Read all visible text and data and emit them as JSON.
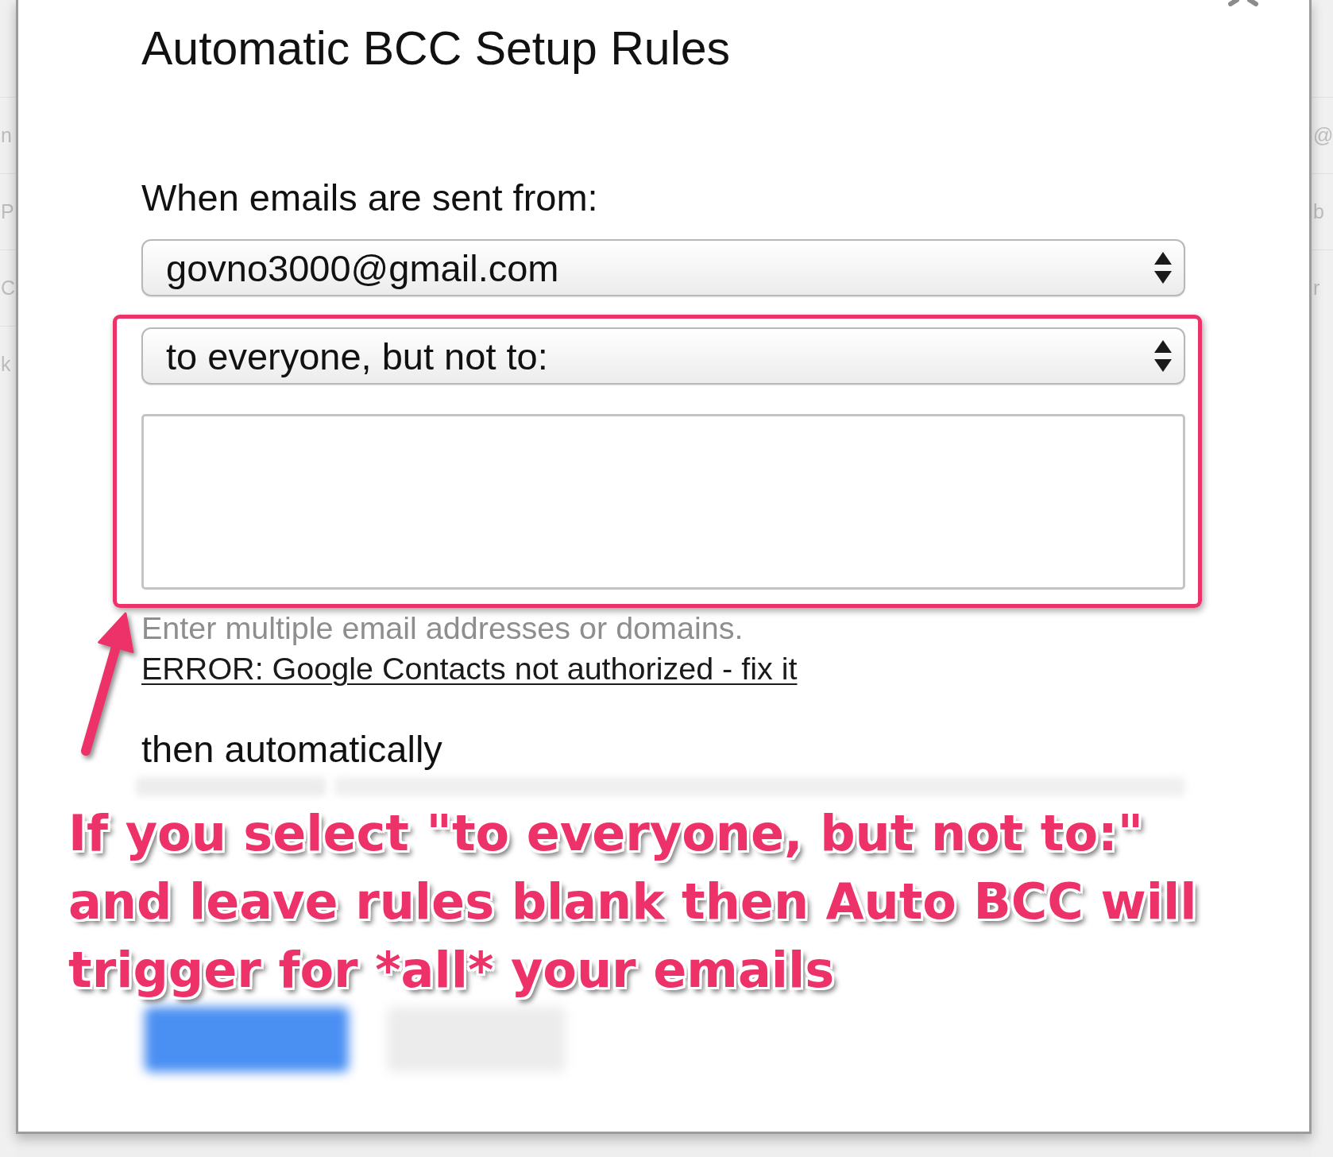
{
  "background_list": {
    "left_rows": [
      {
        "text": "n"
      },
      {
        "text": "P"
      },
      {
        "text": "C"
      },
      {
        "text": "k"
      }
    ],
    "right_rows": [
      {
        "text": "@"
      },
      {
        "text": "b"
      },
      {
        "text": "r"
      }
    ]
  },
  "dialog": {
    "title": "Automatic BCC Setup Rules",
    "from_label": "When emails are sent from:",
    "from_select": {
      "value": "govno3000@gmail.com"
    },
    "recipient_select": {
      "value": "to everyone, but not to:"
    },
    "hint": "Enter multiple email addresses or domains.",
    "error_link": "ERROR: Google Contacts not authorized - fix it",
    "then_label": "then automatically"
  },
  "annotation": {
    "lines": [
      "If you select \"to everyone, but not to:\"",
      "and leave rules blank then Auto BCC will",
      "trigger for *all* your emails"
    ]
  }
}
